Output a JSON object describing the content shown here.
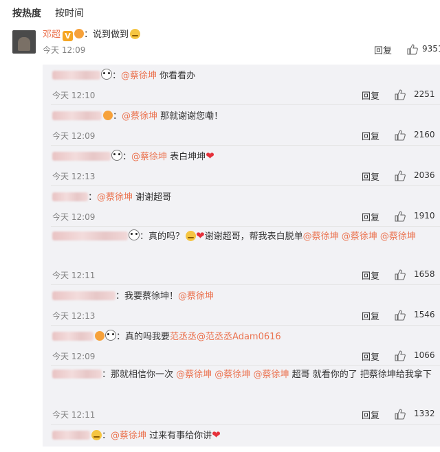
{
  "tabs": {
    "hot": "按热度",
    "time": "按时间"
  },
  "main": {
    "user": "邓超",
    "text": "：说到做到",
    "time": "今天 12:09",
    "reply": "回复",
    "likes": "9351"
  },
  "replies": [
    {
      "parts": [
        {
          "t": "plain",
          "v": "："
        },
        {
          "t": "mention",
          "v": "@蔡徐坤"
        },
        {
          "t": "plain",
          "v": "  你看看办"
        }
      ],
      "time": "今天 12:10",
      "likes": "2251"
    },
    {
      "parts": [
        {
          "t": "plain",
          "v": "："
        },
        {
          "t": "mention",
          "v": "@蔡徐坤"
        },
        {
          "t": "plain",
          "v": " 那就谢谢您嘞！"
        }
      ],
      "time": "今天 12:09",
      "likes": "2160"
    },
    {
      "parts": [
        {
          "t": "plain",
          "v": "："
        },
        {
          "t": "mention",
          "v": "@蔡徐坤"
        },
        {
          "t": "plain",
          "v": "  表白坤坤"
        }
      ],
      "time": "今天 12:13",
      "likes": "2036"
    },
    {
      "parts": [
        {
          "t": "plain",
          "v": "："
        },
        {
          "t": "mention",
          "v": "@蔡徐坤"
        },
        {
          "t": "plain",
          "v": "  谢谢超哥"
        }
      ],
      "time": "今天 12:09",
      "likes": "1910"
    },
    {
      "parts": [
        {
          "t": "plain",
          "v": "：真的吗？"
        },
        {
          "t": "plain",
          "v": "谢谢超哥，帮我表白脱单"
        },
        {
          "t": "mention",
          "v": "@蔡徐坤"
        },
        {
          "t": "plain",
          "v": " "
        },
        {
          "t": "mention",
          "v": "@蔡徐坤"
        },
        {
          "t": "plain",
          "v": " "
        },
        {
          "t": "mention",
          "v": "@蔡徐坤"
        }
      ],
      "time": "今天 12:11",
      "likes": "1658"
    },
    {
      "parts": [
        {
          "t": "plain",
          "v": "：我要蔡徐坤！"
        },
        {
          "t": "mention",
          "v": "@蔡徐坤"
        }
      ],
      "time": "今天 12:13",
      "likes": "1546"
    },
    {
      "parts": [
        {
          "t": "plain",
          "v": "：真的吗我要"
        },
        {
          "t": "mention",
          "v": "范丞丞"
        },
        {
          "t": "mention",
          "v": "@范丞丞Adam0616"
        }
      ],
      "time": "今天 12:09",
      "likes": "1066"
    },
    {
      "parts": [
        {
          "t": "plain",
          "v": "：那就相信你一次  "
        },
        {
          "t": "mention",
          "v": "@蔡徐坤"
        },
        {
          "t": "plain",
          "v": " "
        },
        {
          "t": "mention",
          "v": "@蔡徐坤"
        },
        {
          "t": "plain",
          "v": " "
        },
        {
          "t": "mention",
          "v": "@蔡徐坤"
        },
        {
          "t": "plain",
          "v": "  超哥  就看你的了  把蔡徐坤给我拿下"
        }
      ],
      "time": "今天 12:11",
      "likes": "1332"
    },
    {
      "parts": [
        {
          "t": "plain",
          "v": "："
        },
        {
          "t": "mention",
          "v": "@蔡徐坤"
        },
        {
          "t": "plain",
          "v": "  过来有事给你讲"
        }
      ],
      "time": "",
      "likes": ""
    }
  ],
  "reply_label": "回复",
  "colors": {
    "mention": "#eb7350",
    "panel": "#f2f2f5"
  },
  "icons": {
    "like": "thumbs-up-icon",
    "verified": "verified-v-icon",
    "panda": "panda-emoji-icon",
    "heart": "heart-icon",
    "doge": "doge-face-icon"
  }
}
